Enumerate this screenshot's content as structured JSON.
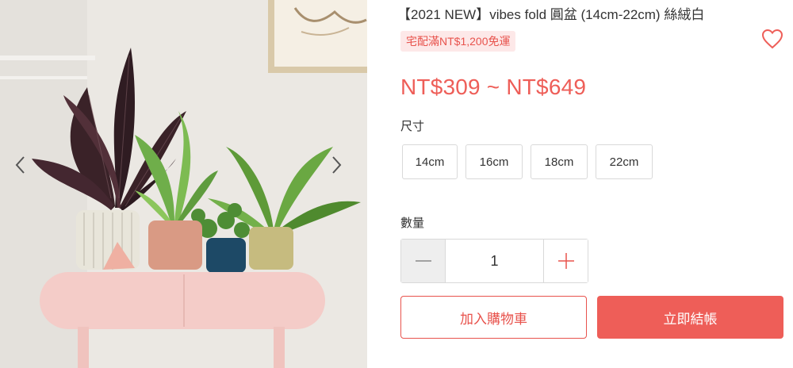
{
  "product": {
    "title": "【2021 NEW】vibes fold 圓盆 (14cm-22cm) 絲絨白",
    "shipping_badge": "宅配滿NT$1,200免運",
    "price": "NT$309 ~ NT$649"
  },
  "options": {
    "size_label": "尺寸",
    "sizes": [
      "14cm",
      "16cm",
      "18cm",
      "22cm"
    ]
  },
  "quantity": {
    "label": "數量",
    "value": "1"
  },
  "actions": {
    "add_to_cart": "加入購物車",
    "buy_now": "立即結帳"
  },
  "icons": {
    "favorite": "heart-icon",
    "prev": "chevron-left-icon",
    "next": "chevron-right-icon",
    "minus": "minus-icon",
    "plus": "plus-icon"
  },
  "colors": {
    "accent": "#ee5e58",
    "badge_bg": "#fde8e8"
  }
}
